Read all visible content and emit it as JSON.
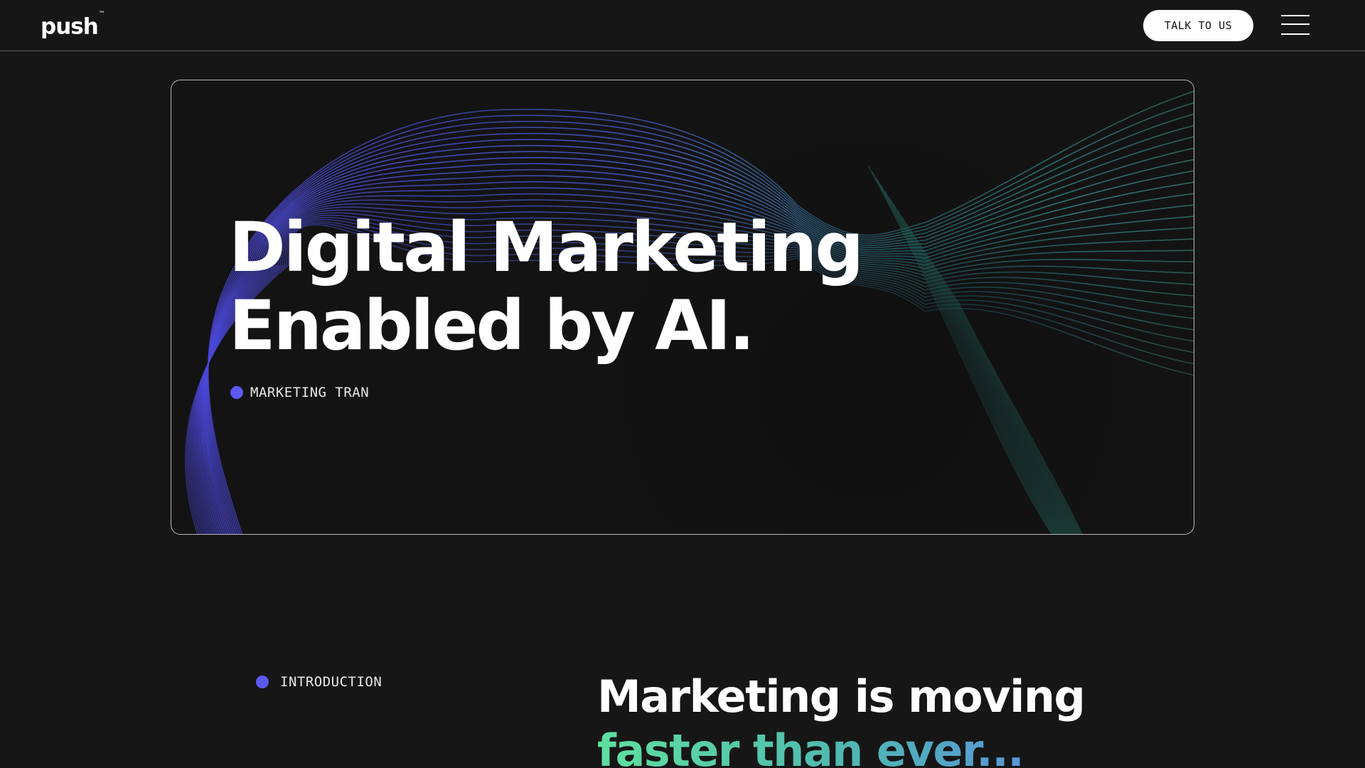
{
  "header": {
    "logo_text": "push",
    "logo_mark": "™",
    "cta_label": "TALK TO US",
    "menu_icon": "hamburger-menu-icon"
  },
  "hero": {
    "title_line1": "Digital Marketing",
    "title_line2": "Enabled by AI.",
    "tag_label": "MARKETING TRAN"
  },
  "intro": {
    "tag_label": "INTRODUCTION",
    "heading_line1": "Marketing is moving",
    "heading_line2": "faster than ever..."
  },
  "colors": {
    "background": "#161616",
    "accent_dot": "#5b59f0",
    "wave_purple": "#5555e8",
    "wave_teal": "#3fb59a",
    "gradient_start": "#5fe0a0",
    "gradient_end": "#6a6af0"
  }
}
